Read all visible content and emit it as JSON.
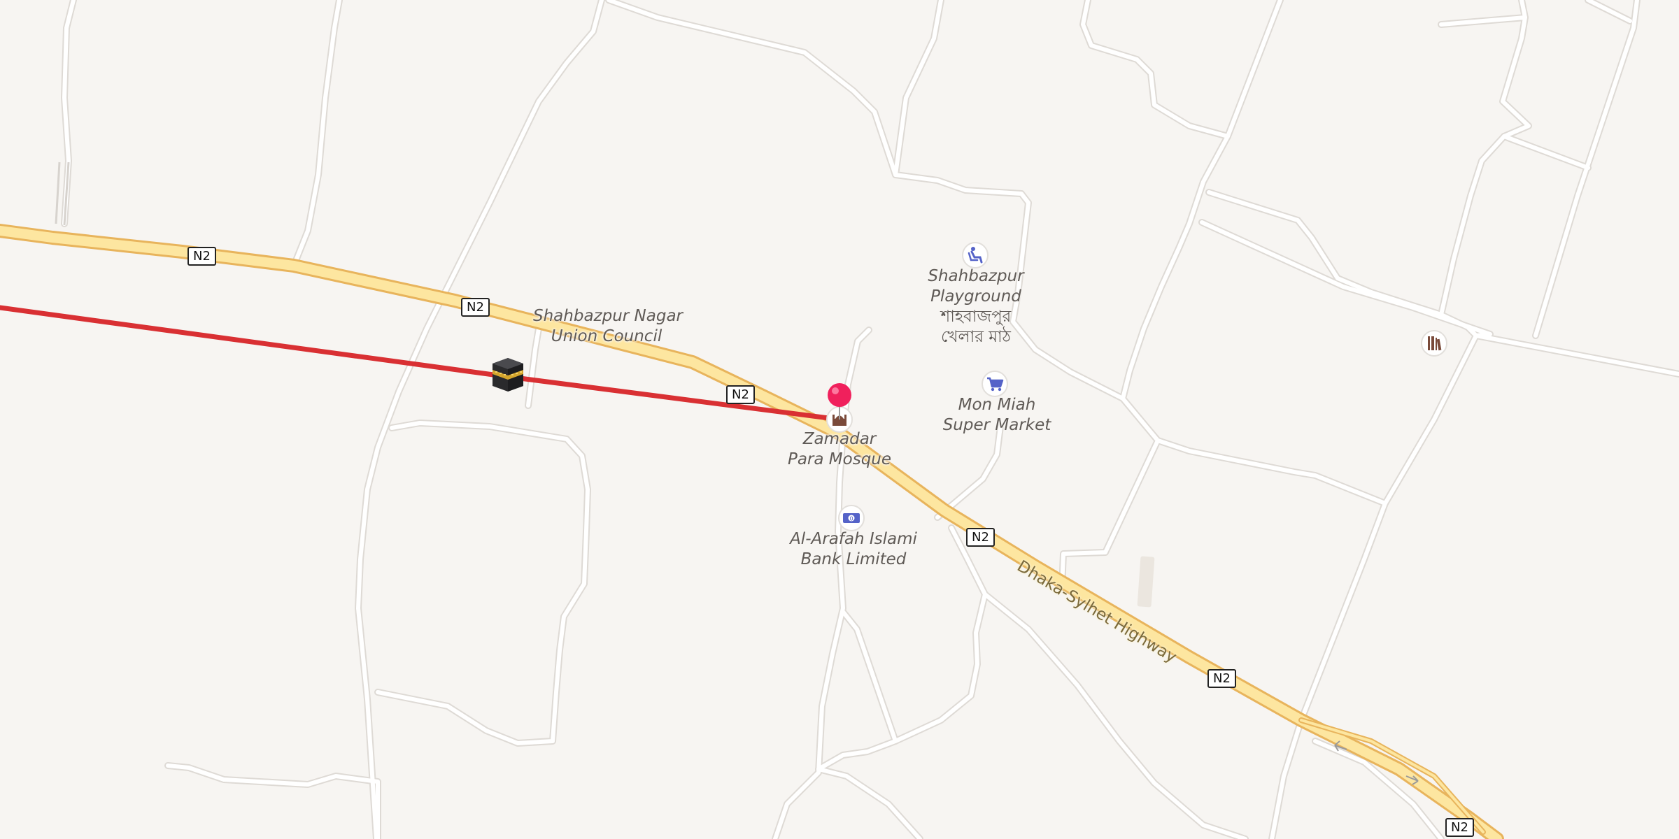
{
  "map": {
    "colors": {
      "background": "#f7f5f2",
      "minor_road": "#ffffff",
      "road_casing": "#dedad5",
      "highway_fill": "#fde6a0",
      "highway_casing": "#e8b45c",
      "route_line": "#d93033",
      "marker": "#f0205c"
    },
    "road_shields": [
      {
        "ref": "N2"
      },
      {
        "ref": "N2"
      },
      {
        "ref": "N2"
      },
      {
        "ref": "N2"
      },
      {
        "ref": "N2"
      },
      {
        "ref": "N2"
      }
    ],
    "highway_name": "Dhaka-Sylhet Highway",
    "places": {
      "union_council": {
        "line1": "Shahbazpur Nagar",
        "line2": "Union Council"
      },
      "mosque": {
        "line1": "Zamadar",
        "line2": "Para Mosque",
        "icon": "mosque-icon"
      },
      "playground": {
        "line1": "Shahbazpur",
        "line2": "Playground",
        "native1": "শাহবাজপুর",
        "native2": "খেলার মাঠ",
        "icon": "playground-icon"
      },
      "supermarket": {
        "line1": "Mon Miah",
        "line2": "Super Market",
        "icon": "shopping-cart-icon"
      },
      "bank": {
        "line1": "Al-Arafah Islami",
        "line2": "Bank Limited",
        "icon": "bank-note-icon"
      },
      "unnamed_poi": {
        "icon": "library-icon"
      }
    },
    "route": {
      "destination_icon": "kaaba-icon",
      "marker_icon": "location-pin-icon"
    }
  }
}
